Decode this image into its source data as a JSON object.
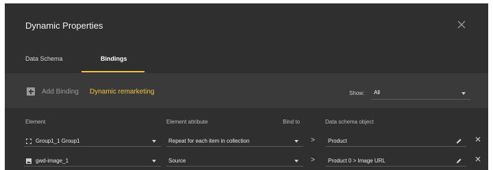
{
  "dialog": {
    "title": "Dynamic Properties",
    "close_icon": "close-icon"
  },
  "tabs": [
    {
      "label": "Data Schema",
      "active": false
    },
    {
      "label": "Bindings",
      "active": true
    }
  ],
  "accent_color": "#f6c342",
  "toolbar": {
    "add_icon": "plus-box-icon",
    "add_label": "Add Binding",
    "dynamic_label": "Dynamic remarketing",
    "show_label": "Show:",
    "show_value": "All"
  },
  "table": {
    "headers": {
      "element": "Element",
      "attribute": "Element attribute",
      "bind_to": "Bind to",
      "schema_object": "Data schema object"
    },
    "rows": [
      {
        "element_icon": "group-icon",
        "element": "Group1_1 Group1",
        "attribute": "Repeat for each item in collection",
        "schema_object": "Product"
      },
      {
        "element_icon": "image-icon",
        "element": "gwd-image_1",
        "attribute": "Source",
        "schema_object": "Product 0 > Image URL"
      }
    ]
  }
}
